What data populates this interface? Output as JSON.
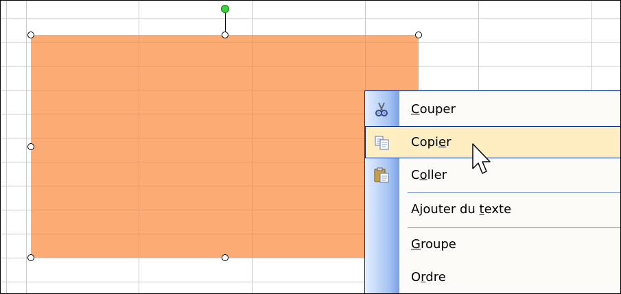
{
  "context_menu": {
    "items": [
      {
        "id": "cut",
        "before": "",
        "accel": "C",
        "after": "ouper",
        "icon": "scissors-icon"
      },
      {
        "id": "copy",
        "before": "Copi",
        "accel": "e",
        "after": "r",
        "icon": "copy-icon",
        "highlighted": true
      },
      {
        "id": "paste",
        "before": "C",
        "accel": "o",
        "after": "ller",
        "icon": "paste-icon"
      },
      {
        "id": "add-text",
        "before": "Ajouter du ",
        "accel": "t",
        "after": "exte",
        "icon": ""
      },
      {
        "id": "group",
        "before": "",
        "accel": "G",
        "after": "roupe",
        "icon": ""
      },
      {
        "id": "order",
        "before": "O",
        "accel": "r",
        "after": "dre",
        "icon": ""
      }
    ]
  },
  "colors": {
    "shape_fill": "#fcab75",
    "menu_border": "#002d96",
    "menu_highlight": "#ffeec2",
    "rotation_handle": "#3cd13c"
  }
}
